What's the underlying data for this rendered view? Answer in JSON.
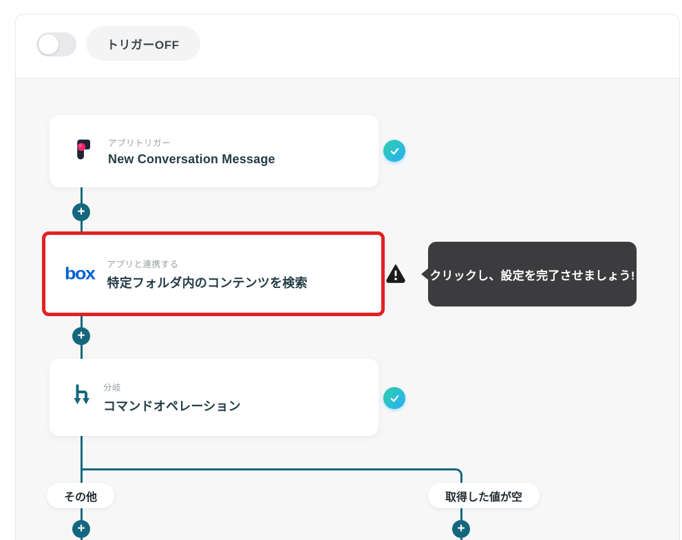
{
  "header": {
    "toggle_state": "off",
    "trigger_badge": "トリガーOFF"
  },
  "workflow": {
    "nodes": [
      {
        "app": "front",
        "type_label": "アプリトリガー",
        "title": "New Conversation Message",
        "status": "complete"
      },
      {
        "app": "box",
        "app_wordmark": "box",
        "type_label": "アプリと連携する",
        "title": "特定フォルダ内のコンテンツを検索",
        "status": "warning",
        "highlighted": true
      },
      {
        "app": "branch",
        "type_label": "分岐",
        "title": "コマンドオペレーション",
        "status": "complete"
      }
    ],
    "tooltip": {
      "text": "クリックし、設定を完了させましょう!"
    },
    "branch_labels": [
      {
        "label": "その他"
      },
      {
        "label": "取得した値が空"
      }
    ]
  },
  "colors": {
    "connector_teal": "#14677D",
    "highlight_red": "#E02222",
    "badge_gradient_start": "#30CFA5",
    "badge_gradient_end": "#29B2F2",
    "box_blue": "#0061D5",
    "tooltip_bg": "#3C3C3E",
    "body_bg": "#F7F7F8"
  }
}
